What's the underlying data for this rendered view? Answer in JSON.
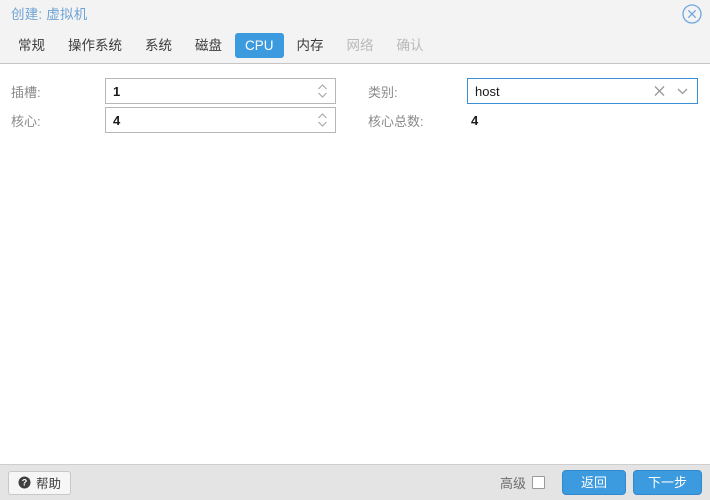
{
  "window": {
    "title": "创建: 虚拟机",
    "close_icon": "close-circle-icon",
    "accent_color": "#3c9ade",
    "title_color": "#6ea3d4"
  },
  "tabs": [
    {
      "label": "常规",
      "state": "enabled"
    },
    {
      "label": "操作系统",
      "state": "enabled"
    },
    {
      "label": "系统",
      "state": "enabled"
    },
    {
      "label": "磁盘",
      "state": "enabled"
    },
    {
      "label": "CPU",
      "state": "active"
    },
    {
      "label": "内存",
      "state": "enabled"
    },
    {
      "label": "网络",
      "state": "disabled"
    },
    {
      "label": "确认",
      "state": "disabled"
    }
  ],
  "form": {
    "sockets": {
      "label": "插槽:",
      "value": "1",
      "spinner_icon": "spinner-arrows-icon"
    },
    "cores": {
      "label": "核心:",
      "value": "4",
      "spinner_icon": "spinner-arrows-icon"
    },
    "type": {
      "label": "类别:",
      "value": "host",
      "clear_icon": "clear-x-icon",
      "caret_icon": "chevron-down-icon",
      "border_color": "#3c8fd2"
    },
    "total_cores": {
      "label": "核心总数:",
      "value": "4"
    }
  },
  "footer": {
    "help_label": "帮助",
    "help_icon": "question-mark-circle-icon",
    "advanced_label": "高级",
    "advanced_checked": false,
    "back_label": "返回",
    "next_label": "下一步"
  }
}
